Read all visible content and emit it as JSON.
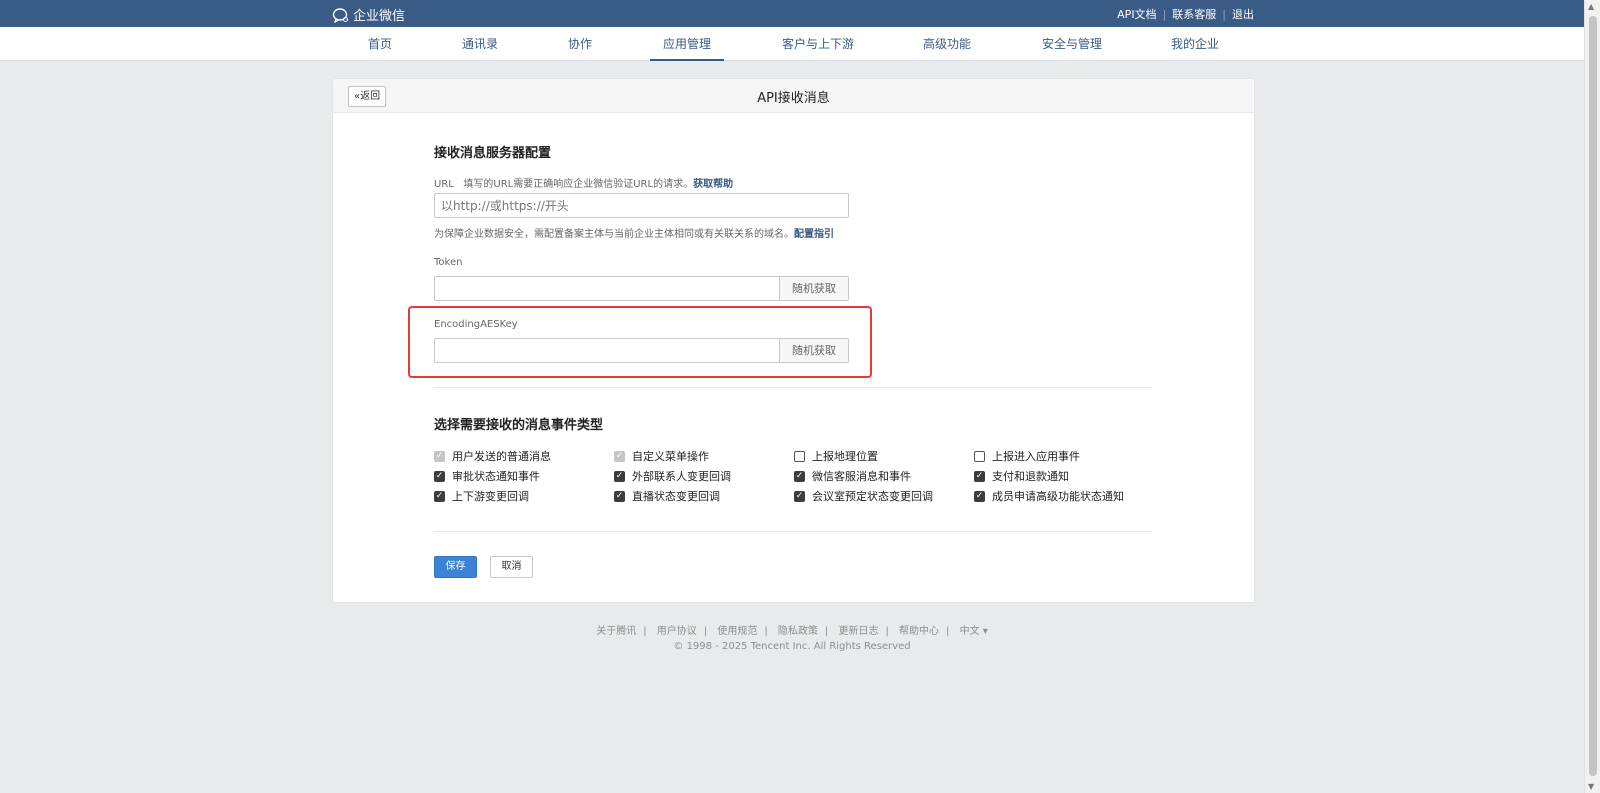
{
  "topbar": {
    "brand": "企业微信",
    "links": [
      "API文档",
      "联系客服",
      "退出"
    ]
  },
  "nav": {
    "items": [
      "首页",
      "通讯录",
      "协作",
      "应用管理",
      "客户与上下游",
      "高级功能",
      "安全与管理",
      "我的企业"
    ],
    "active": "应用管理"
  },
  "card": {
    "back_label": "返回",
    "title": "API接收消息"
  },
  "server_config": {
    "section_title": "接收消息服务器配置",
    "url_label": "URL",
    "url_desc": "填写的URL需要正确响应企业微信验证URL的请求。",
    "url_help_link": "获取帮助",
    "url_placeholder": "以http://或https://开头",
    "url_value": "",
    "security_hint": "为保障企业数据安全，需配置备案主体与当前企业主体相同或有关联关系的域名。",
    "security_link": "配置指引",
    "token_label": "Token",
    "token_value": "",
    "token_random": "随机获取",
    "aes_label": "EncodingAESKey",
    "aes_value": "",
    "aes_random": "随机获取"
  },
  "events": {
    "section_title": "选择需要接收的消息事件类型",
    "items": [
      {
        "label": "用户发送的普通消息",
        "state": "disabled"
      },
      {
        "label": "自定义菜单操作",
        "state": "disabled"
      },
      {
        "label": "上报地理位置",
        "state": "unchecked"
      },
      {
        "label": "上报进入应用事件",
        "state": "unchecked"
      },
      {
        "label": "审批状态通知事件",
        "state": "checked"
      },
      {
        "label": "外部联系人变更回调",
        "state": "checked"
      },
      {
        "label": "微信客服消息和事件",
        "state": "checked"
      },
      {
        "label": "支付和退款通知",
        "state": "checked"
      },
      {
        "label": "上下游变更回调",
        "state": "checked"
      },
      {
        "label": "直播状态变更回调",
        "state": "checked"
      },
      {
        "label": "会议室预定状态变更回调",
        "state": "checked"
      },
      {
        "label": "成员申请高级功能状态通知",
        "state": "checked"
      }
    ]
  },
  "actions": {
    "save": "保存",
    "cancel": "取消"
  },
  "footer": {
    "links": [
      "关于腾讯",
      "用户协议",
      "使用规范",
      "隐私政策",
      "更新日志",
      "帮助中心",
      "中文 ▾"
    ],
    "copyright": "© 1998 - 2025 Tencent Inc. All Rights Reserved"
  },
  "colors": {
    "topbar": "#3a5b86",
    "primary_button": "#3a83d6",
    "highlight": "#e43a3a"
  }
}
